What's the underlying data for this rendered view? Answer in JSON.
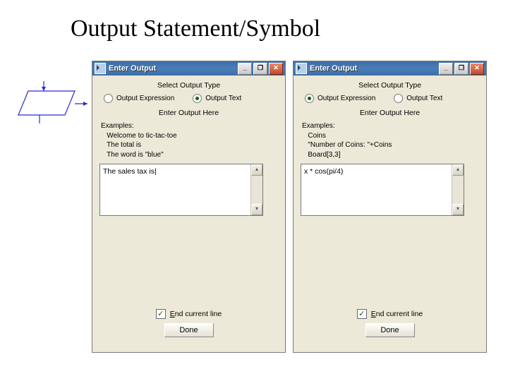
{
  "page_title": "Output Statement/Symbol",
  "dialog": {
    "title": "Enter Output",
    "select_label": "Select Output Type",
    "radio_expression": "Output Expression",
    "radio_text": "Output Text",
    "enter_label": "Enter Output Here",
    "checkbox_label": "End current line",
    "done_label": "Done",
    "minimize": "_",
    "maximize": "❐",
    "close": "✕",
    "scroll_up": "▴",
    "scroll_down": "▾"
  },
  "left": {
    "examples_header": "Examples:",
    "example1": "Welcome to tic-tac-toe",
    "example2": "The total is",
    "example3": "The word is \"blue\"",
    "textarea_value": "The sales tax is|"
  },
  "right": {
    "examples_header": "Examples:",
    "example1": "Coins",
    "example2": "\"Number of Coins: \"+Coins",
    "example3": "Board[3,3]",
    "textarea_value": "x * cos(pi/4)"
  }
}
